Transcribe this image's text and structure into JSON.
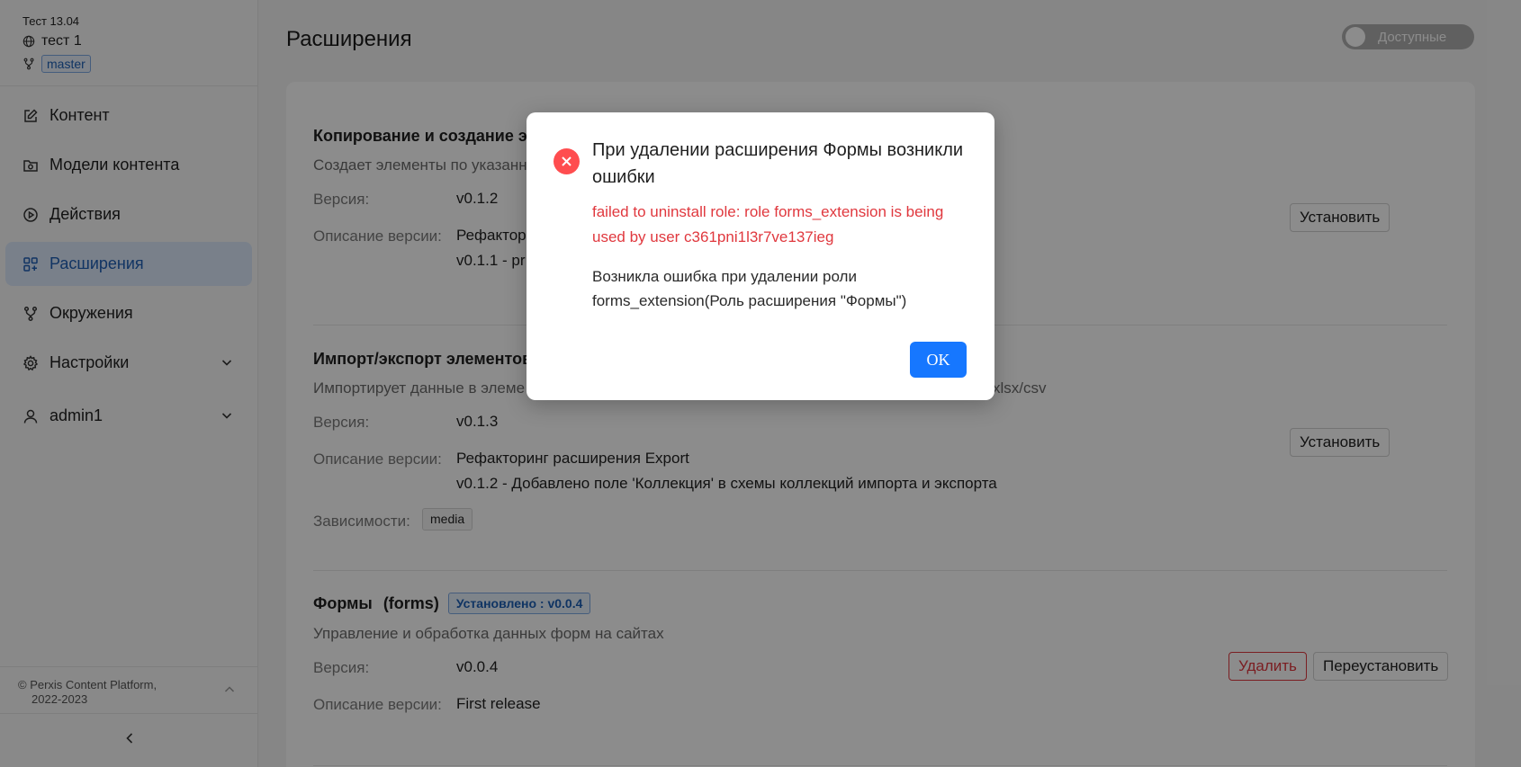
{
  "project": {
    "name": "Тест 13.04",
    "space": "тест 1",
    "branch": "master"
  },
  "nav": {
    "items": [
      {
        "label": "Контент",
        "icon": "edit-icon"
      },
      {
        "label": "Модели контента",
        "icon": "folder-image-icon"
      },
      {
        "label": "Действия",
        "icon": "play-circle-icon"
      },
      {
        "label": "Расширения",
        "icon": "apps-icon",
        "active": true
      },
      {
        "label": "Окружения",
        "icon": "branch-icon"
      },
      {
        "label": "Настройки",
        "icon": "gear-icon",
        "expandable": true
      }
    ],
    "user": "admin1"
  },
  "footer": {
    "copyright_line1": "© Perxis Content Platform,",
    "copyright_line2": "2022-2023"
  },
  "page": {
    "title": "Расширения",
    "toggle_label": "Доступные"
  },
  "labels": {
    "version": "Версия:",
    "version_desc": "Описание версии:",
    "deps": "Зависимости:"
  },
  "extensions": [
    {
      "title": "Копирование и создание эле",
      "desc": "Создает элементы по указанн",
      "version": "v0.1.2",
      "notes": [
        "Рефактор",
        "v0.1.1 - pr"
      ],
      "install_label": "Установить"
    },
    {
      "title": "Импорт/экспорт элементов к",
      "desc": "Импортирует данные в элеме",
      "desc_suffix": "xlsx/csv",
      "version": "v0.1.3",
      "notes": [
        "Рефакторинг расширения Export",
        "v0.1.2 - Добавлено поле 'Коллекция' в схемы коллекций импорта и экспорта"
      ],
      "deps": [
        "media"
      ],
      "install_label": "Установить"
    },
    {
      "title": "Формы",
      "code": "(forms)",
      "status": "Установлено : v0.0.4",
      "desc": "Управление и обработка данных форм на сайтах",
      "version": "v0.0.4",
      "notes": [
        "First release"
      ],
      "delete_label": "Удалить",
      "reinstall_label": "Переустановить"
    }
  ],
  "modal": {
    "title": "При удалении расширения Формы возникли ошибки",
    "error": "failed to uninstall role: role forms_extension is being used by user c361pni1l3r7ve137ieg",
    "message": "Возникла ошибка при удалении роли forms_extension(Роль расширения \"Формы\")",
    "ok_label": "OK"
  },
  "colors": {
    "accent": "#1677ff",
    "error": "#ff4d4f",
    "active_nav_bg": "#dce9fb"
  }
}
